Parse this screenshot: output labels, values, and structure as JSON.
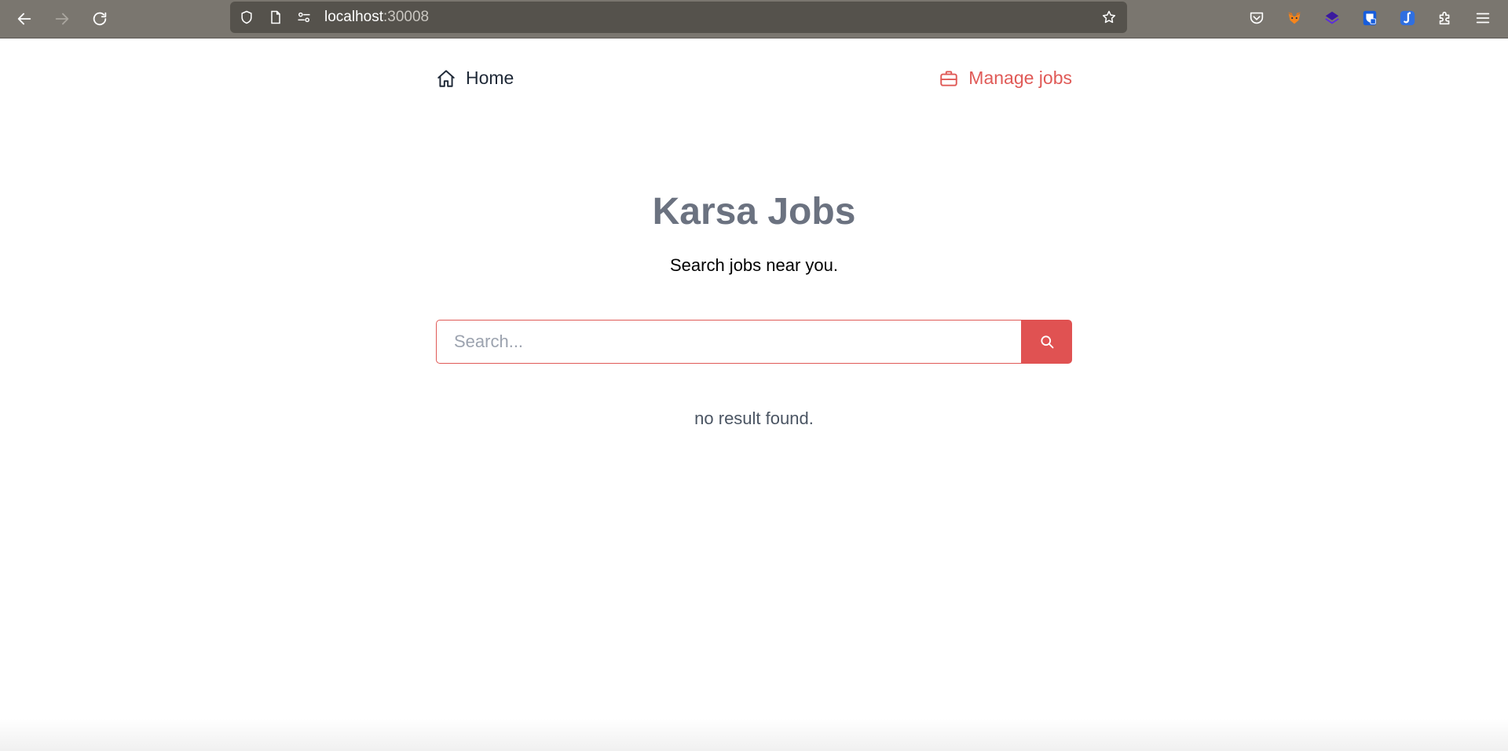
{
  "browser": {
    "url_host": "localhost",
    "url_port": ":30008"
  },
  "nav": {
    "home_label": "Home",
    "manage_label": "Manage jobs"
  },
  "hero": {
    "title": "Karsa Jobs",
    "subtitle": "Search jobs near you."
  },
  "search": {
    "placeholder": "Search...",
    "value": ""
  },
  "results": {
    "empty_message": "no result found."
  },
  "colors": {
    "accent": "#e05252",
    "title": "#6b7280",
    "chrome": "#7a766f"
  }
}
